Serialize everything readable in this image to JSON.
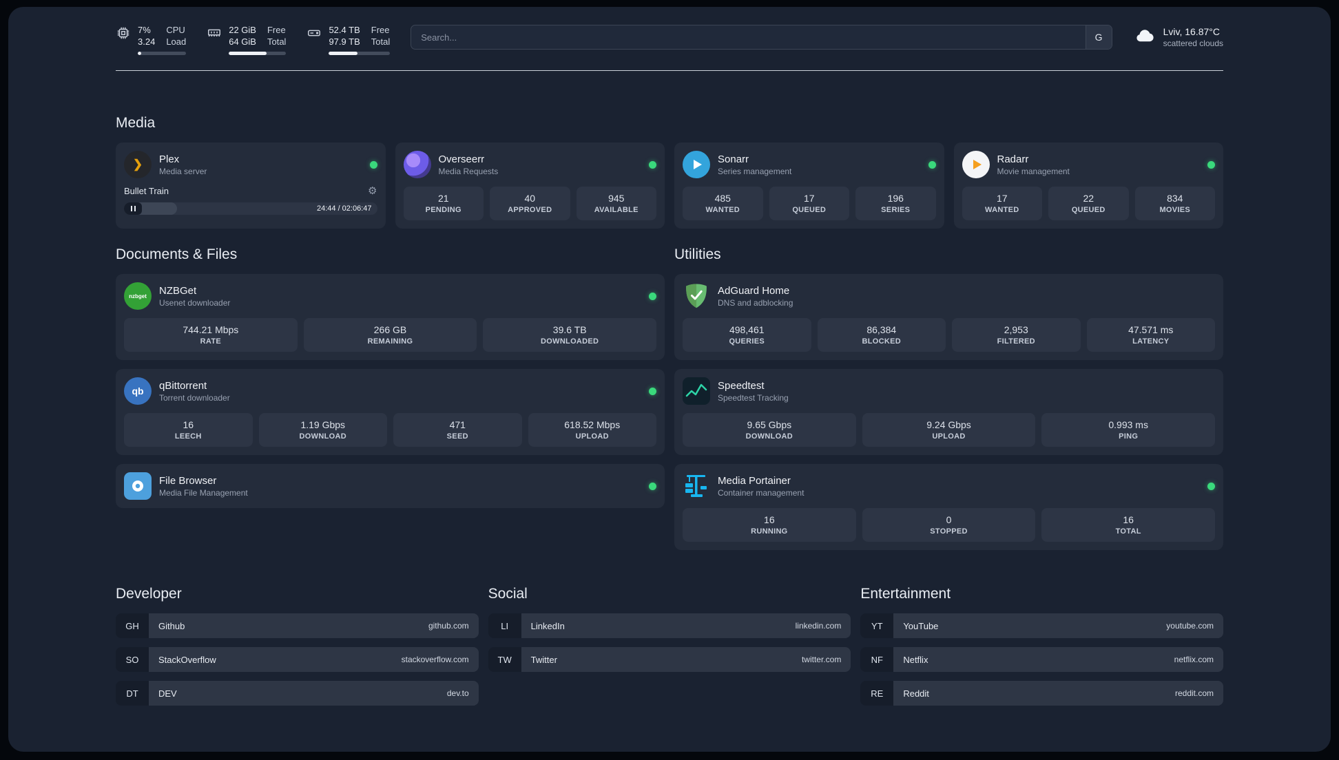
{
  "colors": {
    "background": "#1a2231",
    "card": "#242c3b",
    "tile": "#2d3545",
    "status_online": "#3ad97c",
    "plex_amber": "#e5a00d",
    "adguard_green": "#68bc71",
    "portainer_blue": "#18b6f0"
  },
  "topbar": {
    "cpu": {
      "value_top": "7%",
      "value_bottom": "3.24",
      "label_top": "CPU",
      "label_bottom": "Load",
      "bar_style": "width:7%"
    },
    "memory": {
      "value_top": "22 GiB",
      "value_bottom": "64 GiB",
      "label_top": "Free",
      "label_bottom": "Total",
      "bar_style": "width:66%"
    },
    "storage": {
      "value_top": "52.4 TB",
      "value_bottom": "97.9 TB",
      "label_top": "Free",
      "label_bottom": "Total",
      "bar_style": "width:47%"
    },
    "search": {
      "placeholder": "Search...",
      "engine_label": "G"
    },
    "weather": {
      "location": "Lviv, 16.87°C",
      "condition": "scattered clouds"
    }
  },
  "sections": {
    "media": {
      "title": "Media"
    },
    "documents": {
      "title": "Documents & Files"
    },
    "utilities": {
      "title": "Utilities"
    }
  },
  "apps": {
    "plex": {
      "name": "Plex",
      "desc": "Media server",
      "now_playing": "Bullet Train",
      "time": "24:44 / 02:06:47",
      "progress_style": "width:21%"
    },
    "overseerr": {
      "name": "Overseerr",
      "desc": "Media Requests",
      "stats": [
        {
          "value": "21",
          "label": "PENDING"
        },
        {
          "value": "40",
          "label": "APPROVED"
        },
        {
          "value": "945",
          "label": "AVAILABLE"
        }
      ]
    },
    "sonarr": {
      "name": "Sonarr",
      "desc": "Series management",
      "stats": [
        {
          "value": "485",
          "label": "WANTED"
        },
        {
          "value": "17",
          "label": "QUEUED"
        },
        {
          "value": "196",
          "label": "SERIES"
        }
      ]
    },
    "radarr": {
      "name": "Radarr",
      "desc": "Movie management",
      "stats": [
        {
          "value": "17",
          "label": "WANTED"
        },
        {
          "value": "22",
          "label": "QUEUED"
        },
        {
          "value": "834",
          "label": "MOVIES"
        }
      ]
    },
    "nzbget": {
      "name": "NZBGet",
      "desc": "Usenet downloader",
      "icon_text": "nzbget",
      "stats": [
        {
          "value": "744.21 Mbps",
          "label": "RATE"
        },
        {
          "value": "266 GB",
          "label": "REMAINING"
        },
        {
          "value": "39.6 TB",
          "label": "DOWNLOADED"
        }
      ]
    },
    "qbittorrent": {
      "name": "qBittorrent",
      "desc": "Torrent downloader",
      "icon_text": "qb",
      "stats": [
        {
          "value": "16",
          "label": "LEECH"
        },
        {
          "value": "1.19 Gbps",
          "label": "DOWNLOAD"
        },
        {
          "value": "471",
          "label": "SEED"
        },
        {
          "value": "618.52 Mbps",
          "label": "UPLOAD"
        }
      ]
    },
    "filebrowser": {
      "name": "File Browser",
      "desc": "Media File Management"
    },
    "adguard": {
      "name": "AdGuard Home",
      "desc": "DNS and adblocking",
      "stats": [
        {
          "value": "498,461",
          "label": "QUERIES"
        },
        {
          "value": "86,384",
          "label": "BLOCKED"
        },
        {
          "value": "2,953",
          "label": "FILTERED"
        },
        {
          "value": "47.571 ms",
          "label": "LATENCY"
        }
      ]
    },
    "speedtest": {
      "name": "Speedtest",
      "desc": "Speedtest Tracking",
      "stats": [
        {
          "value": "9.65 Gbps",
          "label": "DOWNLOAD"
        },
        {
          "value": "9.24 Gbps",
          "label": "UPLOAD"
        },
        {
          "value": "0.993 ms",
          "label": "PING"
        }
      ]
    },
    "portainer": {
      "name": "Media Portainer",
      "desc": "Container management",
      "stats": [
        {
          "value": "16",
          "label": "RUNNING"
        },
        {
          "value": "0",
          "label": "STOPPED"
        },
        {
          "value": "16",
          "label": "TOTAL"
        }
      ]
    }
  },
  "bookmarks": {
    "developer": {
      "title": "Developer",
      "items": [
        {
          "abbr": "GH",
          "name": "Github",
          "url": "github.com"
        },
        {
          "abbr": "SO",
          "name": "StackOverflow",
          "url": "stackoverflow.com"
        },
        {
          "abbr": "DT",
          "name": "DEV",
          "url": "dev.to"
        }
      ]
    },
    "social": {
      "title": "Social",
      "items": [
        {
          "abbr": "LI",
          "name": "LinkedIn",
          "url": "linkedin.com"
        },
        {
          "abbr": "TW",
          "name": "Twitter",
          "url": "twitter.com"
        }
      ]
    },
    "entertainment": {
      "title": "Entertainment",
      "items": [
        {
          "abbr": "YT",
          "name": "YouTube",
          "url": "youtube.com"
        },
        {
          "abbr": "NF",
          "name": "Netflix",
          "url": "netflix.com"
        },
        {
          "abbr": "RE",
          "name": "Reddit",
          "url": "reddit.com"
        }
      ]
    }
  }
}
